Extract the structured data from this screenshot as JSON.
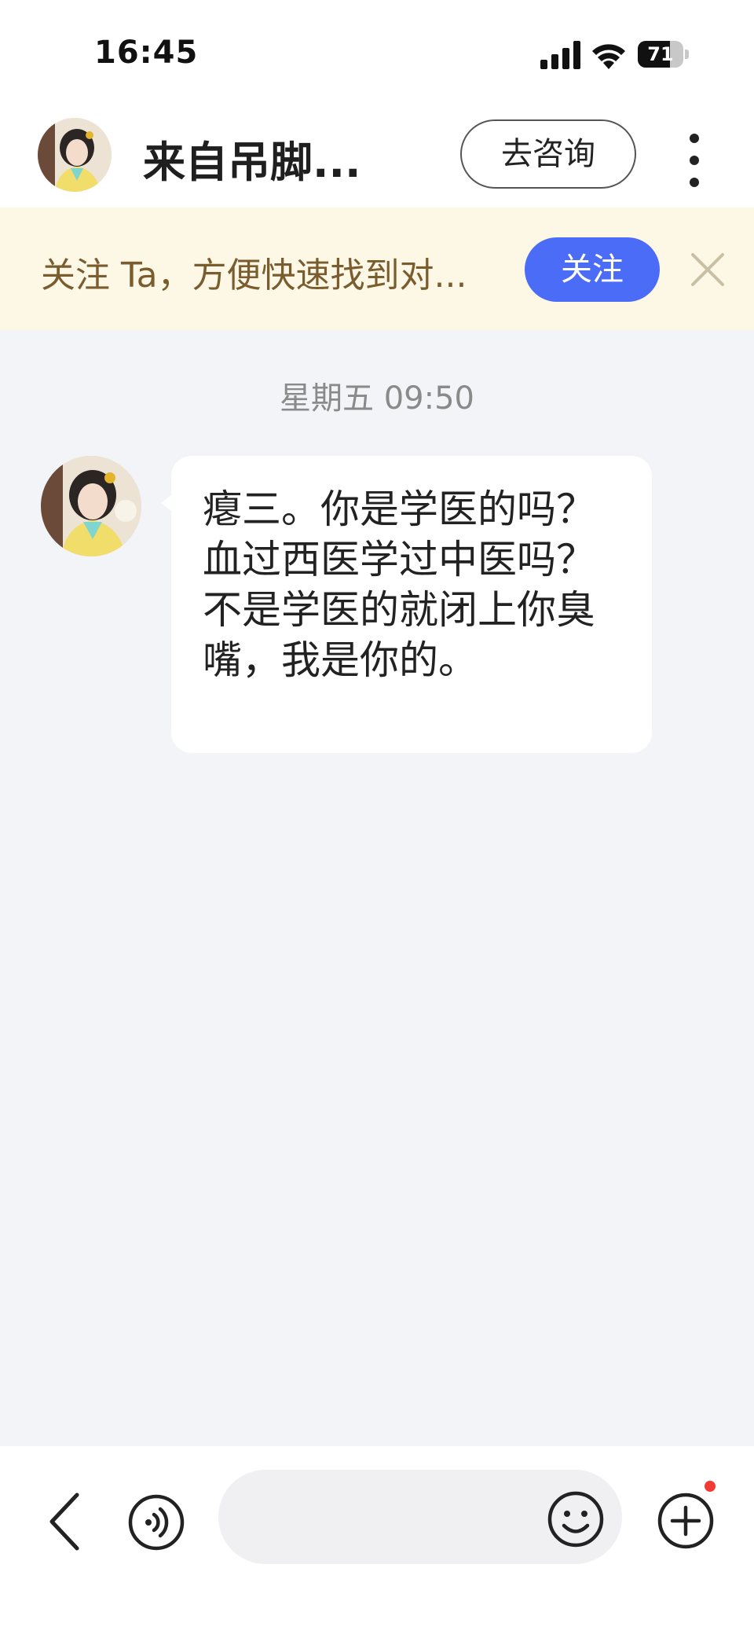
{
  "status_bar": {
    "time": "16:45",
    "battery": "71",
    "battery_level": 0.71,
    "icons": [
      "signal-icon",
      "wifi-icon",
      "battery-icon"
    ]
  },
  "header": {
    "title": "来自吊脚...",
    "consult_label": "去咨询",
    "icons": [
      "avatar",
      "more-icon"
    ]
  },
  "banner": {
    "text": "关注 Ta，方便快速找到对...",
    "follow_label": "关注",
    "icons": [
      "close-icon"
    ]
  },
  "chat": {
    "timestamp": "星期五 09:50",
    "messages": [
      {
        "sender": "other",
        "text": "瘪三。你是学医的吗？血过西医学过中医吗？不是学医的就闭上你臭嘴，我是你的。"
      }
    ]
  },
  "composer": {
    "input_value": "",
    "placeholder": "",
    "icons": [
      "back-icon",
      "voice-icon",
      "emoji-icon",
      "plus-icon"
    ],
    "has_notification_dot": true
  },
  "colors": {
    "accent": "#4a6cf7",
    "banner_bg": "#fdf8e5",
    "banner_text": "#7a5d2f",
    "chat_bg": "#f3f4f8",
    "notification_dot": "#f23b35"
  }
}
